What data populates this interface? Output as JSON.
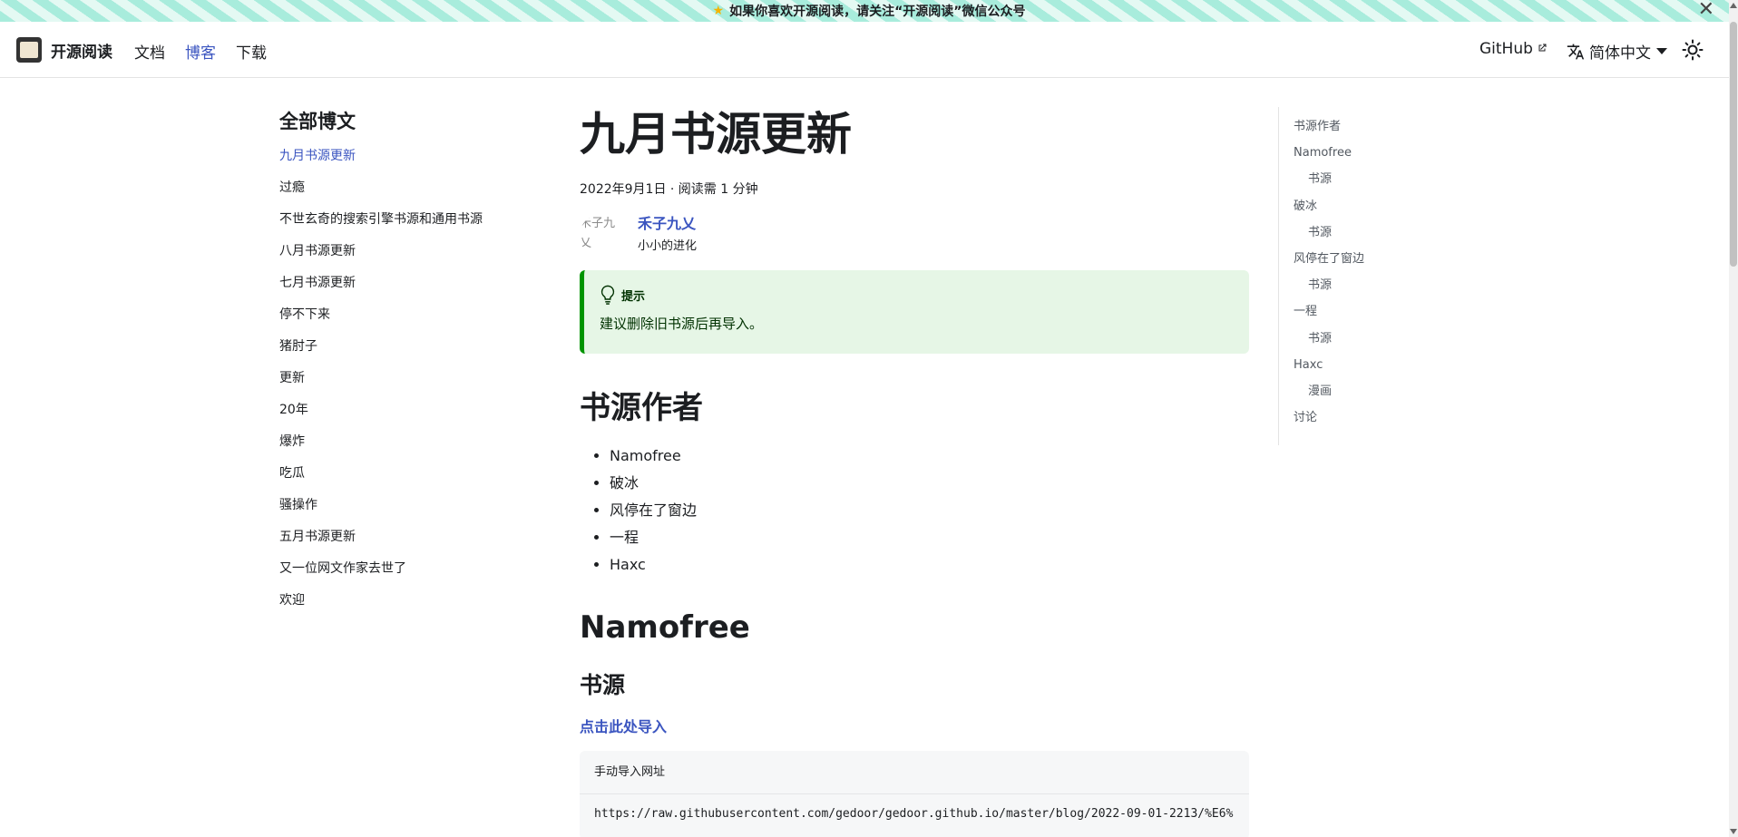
{
  "announcement": {
    "star_icon": "star-icon",
    "text": "如果你喜欢开源阅读，请关注“开源阅读”微信公众号",
    "close_label": "✕"
  },
  "navbar": {
    "brand_title": "开源阅读",
    "links": [
      {
        "label": "文档",
        "active": false
      },
      {
        "label": "博客",
        "active": true
      },
      {
        "label": "下载",
        "active": false
      }
    ],
    "github_label": "GitHub",
    "language_label": "简体中文",
    "accent_color": "#3b55c0"
  },
  "sidebar": {
    "title": "全部博文",
    "items": [
      {
        "label": "九月书源更新",
        "active": true
      },
      {
        "label": "过瘾"
      },
      {
        "label": "不世玄奇的搜索引擎书源和通用书源"
      },
      {
        "label": "八月书源更新"
      },
      {
        "label": "七月书源更新"
      },
      {
        "label": "停不下来"
      },
      {
        "label": "猪肘子"
      },
      {
        "label": "更新"
      },
      {
        "label": "20年"
      },
      {
        "label": "爆炸"
      },
      {
        "label": "吃瓜"
      },
      {
        "label": "骚操作"
      },
      {
        "label": "五月书源更新"
      },
      {
        "label": "又一位网文作家去世了"
      },
      {
        "label": "欢迎"
      }
    ]
  },
  "post": {
    "title": "九月书源更新",
    "meta": "2022年9月1日 · 阅读需 1 分钟",
    "author": {
      "avatar_alt": "禾子九乂",
      "name": "禾子九乂",
      "description": "小小的进化"
    },
    "tip": {
      "label": "提示",
      "text": "建议删除旧书源后再导入。"
    },
    "section_authors": {
      "heading": "书源作者",
      "items": [
        "Namofree",
        "破冰",
        "风停在了窗边",
        "一程",
        "Haxc"
      ]
    },
    "section_namofree": {
      "heading": "Namofree",
      "subheading": "书源",
      "import_link": "点击此处导入",
      "code_title": "手动导入网址",
      "code": "https://raw.githubusercontent.com/gedoor/gedoor.github.io/master/blog/2022-09-01-2213/%E6%"
    }
  },
  "toc": {
    "items": [
      {
        "label": "书源作者",
        "sub": false
      },
      {
        "label": "Namofree",
        "sub": false
      },
      {
        "label": "书源",
        "sub": true
      },
      {
        "label": "破冰",
        "sub": false
      },
      {
        "label": "书源",
        "sub": true
      },
      {
        "label": "风停在了窗边",
        "sub": false
      },
      {
        "label": "书源",
        "sub": true
      },
      {
        "label": "一程",
        "sub": false
      },
      {
        "label": "书源",
        "sub": true
      },
      {
        "label": "Haxc",
        "sub": false
      },
      {
        "label": "漫画",
        "sub": true
      },
      {
        "label": "讨论",
        "sub": false
      }
    ]
  }
}
